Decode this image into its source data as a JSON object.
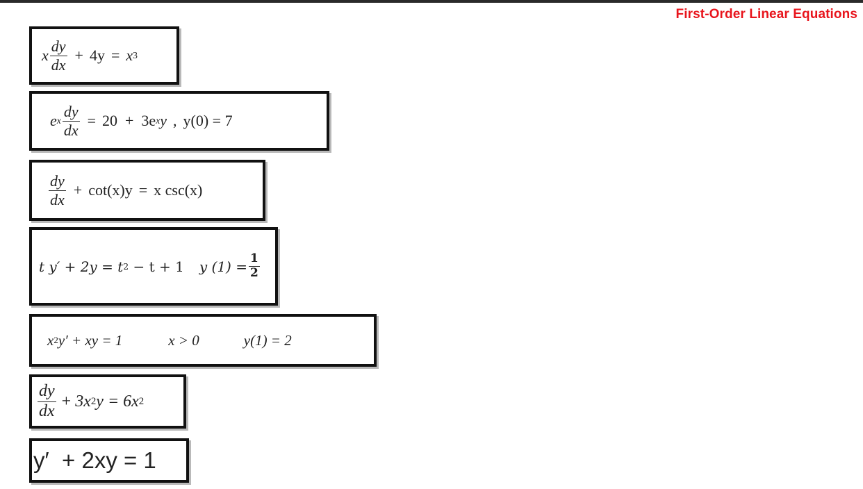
{
  "header": {
    "title": "First-Order Linear Equations"
  },
  "equations": [
    {
      "x": "x",
      "dy": "dy",
      "dx": "dx",
      "plus": "+",
      "term": "4y",
      "equals": "=",
      "rhs": "x",
      "rhs_exp": "3"
    },
    {
      "ex": "e",
      "ex_exp": "x",
      "dy": "dy",
      "dx": "dx",
      "equals": "=",
      "rhs": "20  +  3e",
      "rhs_exp": "x",
      "rhs_tail": "y",
      "comma": ",",
      "ic": "y(0) = 7"
    },
    {
      "dy": "dy",
      "dx": "dx",
      "plus": "+",
      "term": "cot(x)y",
      "equals": "=",
      "rhs": "x csc(x)"
    },
    {
      "lhs": "t y′ + 2y = t",
      "lhs_exp": "2",
      "lhs_tail": " − t + 1",
      "ic": "y (1) =",
      "ic_num": "1",
      "ic_den": "2"
    },
    {
      "lhs_a": "x",
      "lhs_a_exp": "2",
      "lhs_b": "y′ + xy = 1",
      "cond": "x > 0",
      "ic": "y(1) = 2"
    },
    {
      "dy": "dy",
      "dx": "dx",
      "plus": "+",
      "term": "3x",
      "term_exp": "2",
      "term_tail": "y = 6x",
      "rhs_exp": "2"
    },
    {
      "text": "y′  + 2xy = 1"
    }
  ]
}
